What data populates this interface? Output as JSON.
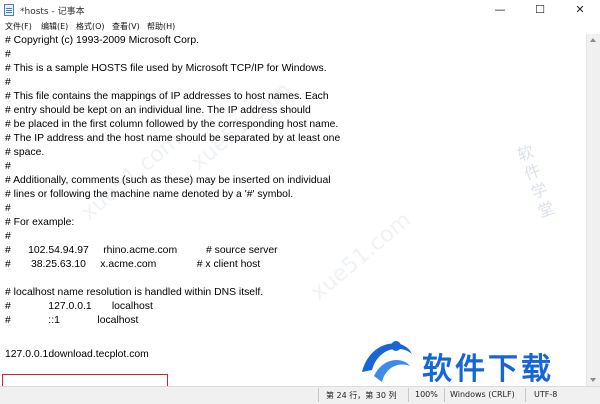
{
  "window": {
    "title": "*hosts - 记事本",
    "minimize": "—",
    "maximize": "☐",
    "close": "✕"
  },
  "menu": [
    "文件(F)",
    "编辑(E)",
    "格式(O)",
    "查看(V)",
    "帮助(H)"
  ],
  "document": {
    "lines": [
      "# Copyright (c) 1993-2009 Microsoft Corp.",
      "#",
      "# This is a sample HOSTS file used by Microsoft TCP/IP for Windows.",
      "#",
      "# This file contains the mappings of IP addresses to host names. Each",
      "# entry should be kept on an individual line. The IP address should",
      "# be placed in the first column followed by the corresponding host name.",
      "# The IP address and the host name should be separated by at least one",
      "# space.",
      "#",
      "# Additionally, comments (such as these) may be inserted on individual",
      "# lines or following the machine name denoted by a '#' symbol.",
      "#",
      "# For example:",
      "#",
      "#      102.54.94.97     rhino.acme.com          # source server",
      "#       38.25.63.10     x.acme.com              # x client host",
      "",
      "# localhost name resolution is handled within DNS itself.",
      "#             127.0.0.1       localhost",
      "#             ::1             localhost",
      "",
      "",
      "127.0.0.1download.tecplot.com"
    ]
  },
  "status": {
    "position": "第 24 行，第 30 列",
    "zoom": "100%",
    "line_ending": "Windows (CRLF)",
    "encoding": "UTF-8"
  },
  "watermark": {
    "logo": "软件下载",
    "side": "软件学堂",
    "diag1": "xue51.com",
    "diag2": "xue51.com",
    "diag3": "xue51.com"
  },
  "colors": {
    "highlight": "#c8262c",
    "logo": "#1666d8"
  }
}
